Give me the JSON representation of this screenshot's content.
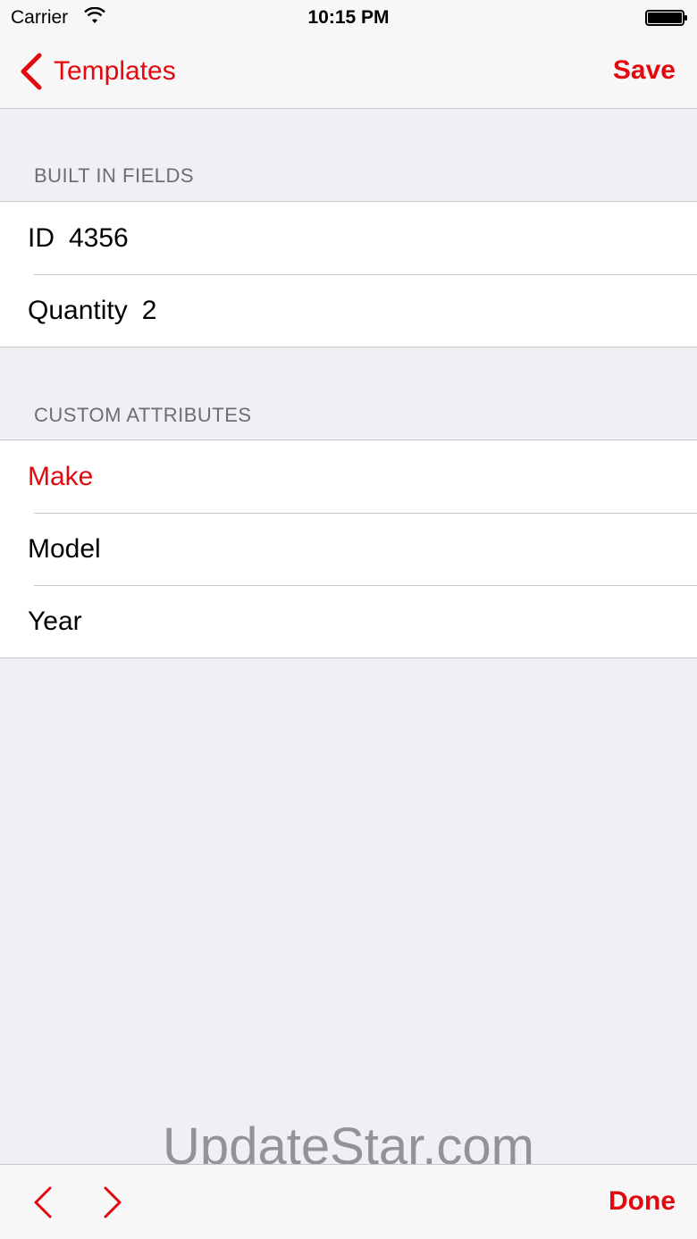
{
  "status_bar": {
    "carrier": "Carrier",
    "time": "10:15 PM"
  },
  "nav": {
    "back_label": "Templates",
    "save_label": "Save"
  },
  "built_in": {
    "header": "BUILT IN FIELDS",
    "rows": [
      {
        "label": "ID",
        "value": "4356"
      },
      {
        "label": "Quantity",
        "value": "2"
      }
    ]
  },
  "custom": {
    "header": "CUSTOM ATTRIBUTES",
    "rows": [
      {
        "label": "Make"
      },
      {
        "label": "Model"
      },
      {
        "label": "Year"
      }
    ]
  },
  "watermark": "UpdateStar.com",
  "toolbar": {
    "done_label": "Done"
  },
  "colors": {
    "accent": "#e3080e",
    "background": "#efeff4"
  }
}
